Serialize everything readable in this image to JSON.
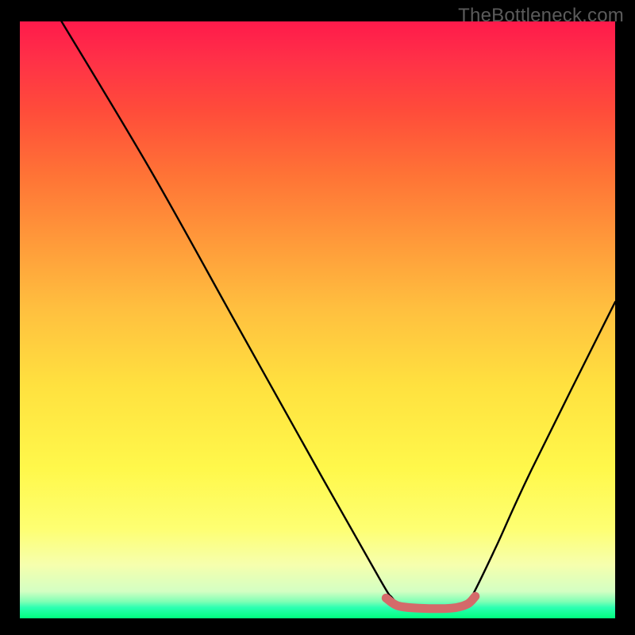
{
  "watermark": "TheBottleneck.com",
  "chart_data": {
    "type": "line",
    "title": "",
    "xlabel": "",
    "ylabel": "",
    "xlim": [
      0,
      100
    ],
    "ylim": [
      0,
      100
    ],
    "series": [
      {
        "name": "bottleneck-curve",
        "xy": [
          [
            7,
            100
          ],
          [
            22,
            75
          ],
          [
            36,
            50
          ],
          [
            50,
            25
          ],
          [
            60.5,
            6.5
          ],
          [
            62.5,
            3.5
          ],
          [
            64,
            2.2
          ],
          [
            66,
            1.7
          ],
          [
            72,
            1.7
          ],
          [
            74.5,
            2.2
          ],
          [
            76,
            3.8
          ],
          [
            80,
            12
          ],
          [
            86,
            25
          ],
          [
            100,
            53
          ]
        ]
      },
      {
        "name": "optimal-range-marker",
        "xy": [
          [
            61.5,
            3.4
          ],
          [
            63.5,
            2.1
          ],
          [
            67,
            1.7
          ],
          [
            72.5,
            1.7
          ],
          [
            75.2,
            2.4
          ],
          [
            76.5,
            3.7
          ]
        ]
      }
    ],
    "marker_color": "#d46a6a",
    "curve_color": "#000000",
    "grid": false
  },
  "colors": {
    "gradient_top": "#ff1a4b",
    "gradient_mid": "#ffe13f",
    "gradient_bottom": "#00ff7e",
    "background": "#000000",
    "marker": "#d46a6a"
  }
}
